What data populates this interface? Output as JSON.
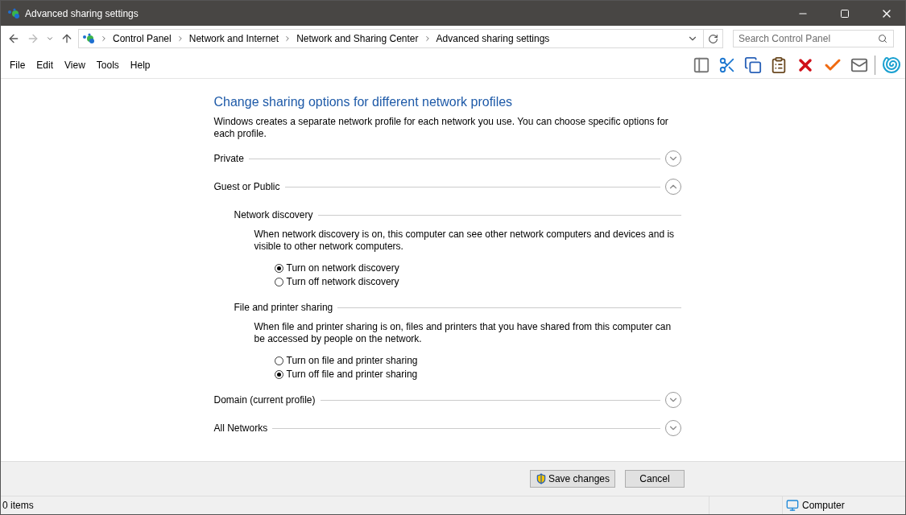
{
  "window": {
    "title": "Advanced sharing settings"
  },
  "address_bar": {
    "breadcrumbs": [
      "Control Panel",
      "Network and Internet",
      "Network and Sharing Center",
      "Advanced sharing settings"
    ]
  },
  "search": {
    "placeholder": "Search Control Panel"
  },
  "menu": [
    "File",
    "Edit",
    "View",
    "Tools",
    "Help"
  ],
  "heading": "Change sharing options for different network profiles",
  "intro": "Windows creates a separate network profile for each network you use. You can choose specific options for each profile.",
  "profiles": [
    {
      "name": "Private",
      "expanded": false
    },
    {
      "name": "Guest or Public",
      "expanded": true,
      "sections": [
        {
          "title": "Network discovery",
          "description": "When network discovery is on, this computer can see other network computers and devices and is visible to other network computers.",
          "options": [
            {
              "label": "Turn on network discovery",
              "selected": true
            },
            {
              "label": "Turn off network discovery",
              "selected": false
            }
          ]
        },
        {
          "title": "File and printer sharing",
          "description": "When file and printer sharing is on, files and printers that you have shared from this computer can be accessed by people on the network.",
          "options": [
            {
              "label": "Turn on file and printer sharing",
              "selected": false
            },
            {
              "label": "Turn off file and printer sharing",
              "selected": true
            }
          ]
        }
      ]
    },
    {
      "name": "Domain (current profile)",
      "expanded": false
    },
    {
      "name": "All Networks",
      "expanded": false
    }
  ],
  "buttons": [
    {
      "label": "Save changes",
      "kind": "shield"
    },
    {
      "label": "Cancel",
      "kind": "plain"
    }
  ],
  "status_bar": {
    "items": "0 items",
    "location": "Computer"
  }
}
